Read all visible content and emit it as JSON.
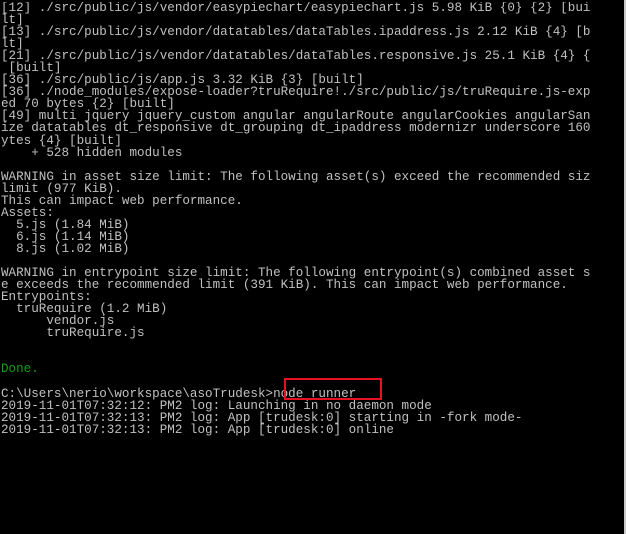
{
  "console": {
    "lines": [
      {
        "text": "[12] ./src/public/js/vendor/easypiechart/easypiechart.js 5.98 KiB {0} {2} [bui",
        "color": "default"
      },
      {
        "text": "lt]",
        "color": "default"
      },
      {
        "text": "[13] ./src/public/js/vendor/datatables/dataTables.ipaddress.js 2.12 KiB {4} [b",
        "color": "default"
      },
      {
        "text": "lt]",
        "color": "default"
      },
      {
        "text": "[21] ./src/public/js/vendor/datatables/dataTables.responsive.js 25.1 KiB {4} {",
        "color": "default"
      },
      {
        "text": " [built]",
        "color": "default"
      },
      {
        "text": "[36] ./src/public/js/app.js 3.32 KiB {3} [built]",
        "color": "default"
      },
      {
        "text": "[36] ./node_modules/expose-loader?truRequire!./src/public/js/truRequire.js-exp",
        "color": "default"
      },
      {
        "text": "ed 70 bytes {2} [built]",
        "color": "default"
      },
      {
        "text": "[49] multi jquery jquery_custom angular angularRoute angularCookies angularSan",
        "color": "default"
      },
      {
        "text": "ize datatables dt_responsive dt_grouping dt_ipaddress modernizr underscore 160",
        "color": "default"
      },
      {
        "text": "ytes {4} [built]",
        "color": "default"
      },
      {
        "text": "    + 528 hidden modules",
        "color": "default"
      },
      {
        "text": "",
        "color": "default"
      },
      {
        "text": "WARNING in asset size limit: The following asset(s) exceed the recommended siz",
        "color": "default"
      },
      {
        "text": "limit (977 KiB).",
        "color": "default"
      },
      {
        "text": "This can impact web performance.",
        "color": "default"
      },
      {
        "text": "Assets:",
        "color": "default"
      },
      {
        "text": "  5.js (1.84 MiB)",
        "color": "default"
      },
      {
        "text": "  6.js (1.14 MiB)",
        "color": "default"
      },
      {
        "text": "  8.js (1.02 MiB)",
        "color": "default"
      },
      {
        "text": "",
        "color": "default"
      },
      {
        "text": "WARNING in entrypoint size limit: The following entrypoint(s) combined asset s",
        "color": "default"
      },
      {
        "text": "e exceeds the recommended limit (391 KiB). This can impact web performance.",
        "color": "default"
      },
      {
        "text": "Entrypoints:",
        "color": "default"
      },
      {
        "text": "  truRequire (1.2 MiB)",
        "color": "default"
      },
      {
        "text": "      vendor.js",
        "color": "default"
      },
      {
        "text": "      truRequire.js",
        "color": "default"
      },
      {
        "text": "",
        "color": "default"
      },
      {
        "text": "",
        "color": "default"
      },
      {
        "text": "Done.",
        "color": "green"
      },
      {
        "text": "",
        "color": "default"
      },
      {
        "text": "C:\\Users\\nerio\\workspace\\asoTrudesk>node runner",
        "color": "default"
      },
      {
        "text": "2019-11-01T07:32:12: PM2 log: Launching in no daemon mode",
        "color": "default"
      },
      {
        "text": "2019-11-01T07:32:13: PM2 log: App [trudesk:0] starting in -fork mode-",
        "color": "default"
      },
      {
        "text": "2019-11-01T07:32:13: PM2 log: App [trudesk:0] online",
        "color": "default"
      }
    ]
  },
  "colors": {
    "background": "#000000",
    "text": "#c0c0c0",
    "done_green": "#13a10e",
    "highlight_red": "#e81123"
  }
}
